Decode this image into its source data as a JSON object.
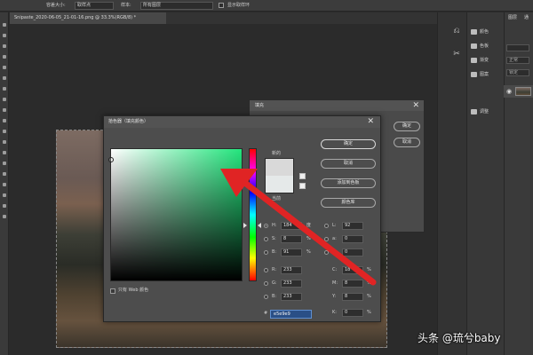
{
  "options_bar": {
    "tolerance_label": "容差大小:",
    "tolerance_value": "取样点",
    "sample_label": "样本:",
    "sample_value": "所有图层",
    "ring_label": "显示取样环"
  },
  "document": {
    "tab_title": "Snipaste_2020-06-05_21-01-16.png @ 33.3%(RGB/8) *"
  },
  "right_panels": {
    "items": [
      "颜色",
      "色板",
      "渐变",
      "图案",
      "调整"
    ],
    "layers_tab": "图层",
    "layers_tab2": "通",
    "layers_kind": "正常",
    "layers_lock": "锁定"
  },
  "fill_dialog": {
    "title": "填充",
    "ok": "确定",
    "cancel": "取消"
  },
  "color_picker": {
    "title": "拾色器（填充颜色）",
    "new_label": "新的",
    "current_label": "当前",
    "buttons": {
      "ok": "确定",
      "cancel": "取消",
      "add_swatch": "添加到色板",
      "libraries": "颜色库"
    },
    "web_only": "只有 Web 颜色",
    "hsb": {
      "h_label": "H:",
      "h_value": "184",
      "h_unit": "度",
      "s_label": "S:",
      "s_value": "8",
      "s_unit": "%",
      "b_label": "B:",
      "b_value": "91",
      "b_unit": "%"
    },
    "lab": {
      "l_label": "L:",
      "l_value": "92",
      "a_label": "a:",
      "a_value": "0",
      "b_label": "b:",
      "b_value": "0"
    },
    "rgb": {
      "r_label": "R:",
      "r_value": "233",
      "g_label": "G:",
      "g_value": "233",
      "b_label": "B:",
      "b_value": "233"
    },
    "cmyk": {
      "c_label": "C:",
      "c_value": "18",
      "c_unit": "%",
      "m_label": "M:",
      "m_value": "8",
      "m_unit": "%",
      "y_label": "Y:",
      "y_value": "8",
      "y_unit": "%",
      "k_label": "K:",
      "k_value": "0",
      "k_unit": "%"
    },
    "hex_label": "#",
    "hex_value": "e5e9e9"
  },
  "watermark": "头条 @琉兮baby",
  "colors": {
    "annotation_arrow": "#e02424",
    "picker_field_hue": "#23e57d",
    "hex_highlight": "#2a4f86"
  }
}
